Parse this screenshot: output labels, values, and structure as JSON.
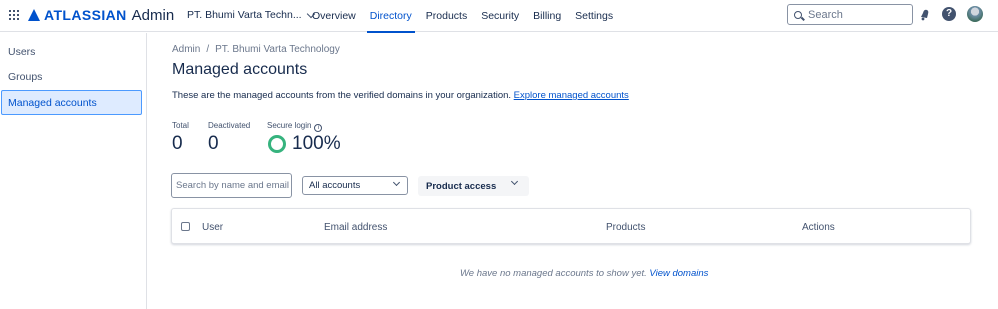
{
  "brand": {
    "name": "ATLASSIAN",
    "product": "Admin"
  },
  "org": {
    "name": "PT. Bhumi Varta Techn..."
  },
  "nav": [
    {
      "label": "Overview",
      "active": false
    },
    {
      "label": "Directory",
      "active": true
    },
    {
      "label": "Products",
      "active": false
    },
    {
      "label": "Security",
      "active": false
    },
    {
      "label": "Billing",
      "active": false
    },
    {
      "label": "Settings",
      "active": false
    }
  ],
  "search": {
    "placeholder": "Search"
  },
  "icons": {
    "notifications": "bell-icon",
    "help": "help-icon",
    "help_glyph": "?",
    "profile": "avatar"
  },
  "colors": {
    "accent": "#0052cc",
    "success_ring": "#36b37e",
    "selected_bg": "#deebff"
  },
  "sidebar": {
    "items": [
      {
        "label": "Users",
        "active": false
      },
      {
        "label": "Groups",
        "active": false
      },
      {
        "label": "Managed accounts",
        "active": true
      }
    ]
  },
  "main": {
    "breadcrumb": [
      "Admin",
      "/",
      "PT. Bhumi Varta Technology"
    ],
    "title": "Managed accounts",
    "description": "These are the managed accounts from the verified domains in your organization.",
    "description_link": "Explore managed accounts",
    "stats": {
      "total_label": "Total",
      "total_value": "0",
      "deactivated_label": "Deactivated",
      "deactivated_value": "0",
      "secure_label": "Secure login",
      "secure_value": "100%",
      "info_glyph": "i"
    },
    "filters": {
      "search_placeholder": "Search by name and email",
      "accounts_select": "All accounts",
      "product_access": "Product access"
    },
    "table": {
      "columns": [
        "User",
        "Email address",
        "Products",
        "Actions"
      ]
    },
    "empty_text": "We have no managed accounts to show yet.",
    "empty_link": "View domains"
  }
}
